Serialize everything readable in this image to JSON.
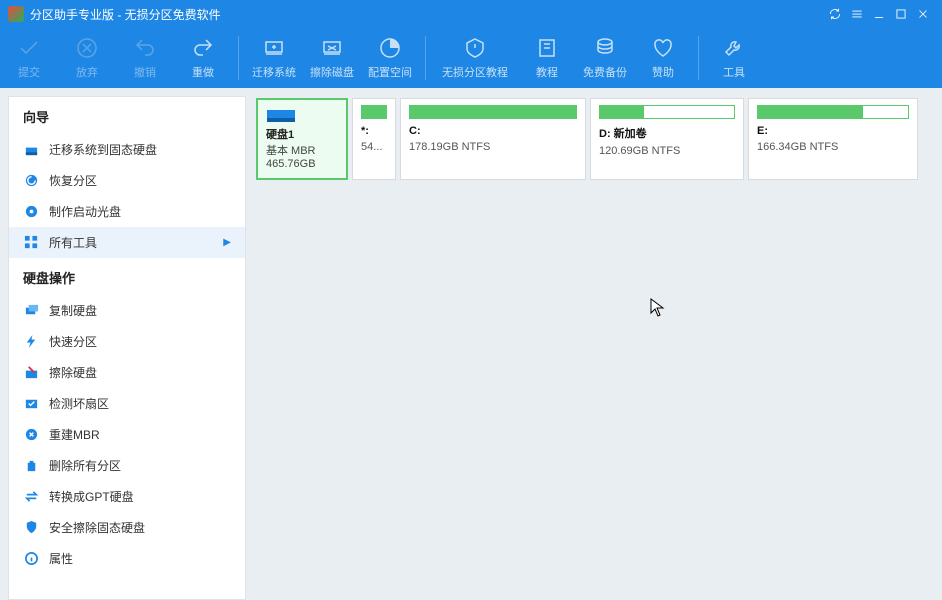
{
  "title": "分区助手专业版 - 无损分区免费软件",
  "toolbar": [
    {
      "label": "提交",
      "disabled": true
    },
    {
      "label": "放弃",
      "disabled": true
    },
    {
      "label": "撤销",
      "disabled": true
    },
    {
      "label": "重做",
      "disabled": false
    },
    {
      "label": "迁移系统",
      "disabled": false
    },
    {
      "label": "擦除磁盘",
      "disabled": false
    },
    {
      "label": "配置空间",
      "disabled": false
    },
    {
      "label": "无损分区教程",
      "disabled": false,
      "wide": true
    },
    {
      "label": "教程",
      "disabled": false
    },
    {
      "label": "免费备份",
      "disabled": false
    },
    {
      "label": "赞助",
      "disabled": false
    },
    {
      "label": "工具",
      "disabled": false
    }
  ],
  "sidebar": {
    "sections": [
      {
        "title": "向导",
        "items": [
          {
            "label": "迁移系统到固态硬盘",
            "icon": "migrate"
          },
          {
            "label": "恢复分区",
            "icon": "recover"
          },
          {
            "label": "制作启动光盘",
            "icon": "bootdisk"
          },
          {
            "label": "所有工具",
            "icon": "grid",
            "expand": true,
            "hl": true
          }
        ]
      },
      {
        "title": "硬盘操作",
        "items": [
          {
            "label": "复制硬盘",
            "icon": "copy"
          },
          {
            "label": "快速分区",
            "icon": "bolt"
          },
          {
            "label": "擦除硬盘",
            "icon": "erase"
          },
          {
            "label": "检测坏扇区",
            "icon": "check"
          },
          {
            "label": "重建MBR",
            "icon": "mbr"
          },
          {
            "label": "删除所有分区",
            "icon": "trash"
          },
          {
            "label": "转换成GPT硬盘",
            "icon": "convert"
          },
          {
            "label": "安全擦除固态硬盘",
            "icon": "secure"
          },
          {
            "label": "属性",
            "icon": "info"
          }
        ]
      }
    ]
  },
  "disk": {
    "name": "硬盘1",
    "type": "基本  MBR",
    "size": "465.76GB"
  },
  "partitions": [
    {
      "label": "*:",
      "info": "54...",
      "fill": 100
    },
    {
      "label": "C:",
      "info": "178.19GB NTFS",
      "fill": 100
    },
    {
      "label": "D: 新加卷",
      "info": "120.69GB NTFS",
      "fill": 33
    },
    {
      "label": "E:",
      "info": "166.34GB NTFS",
      "fill": 70
    }
  ]
}
